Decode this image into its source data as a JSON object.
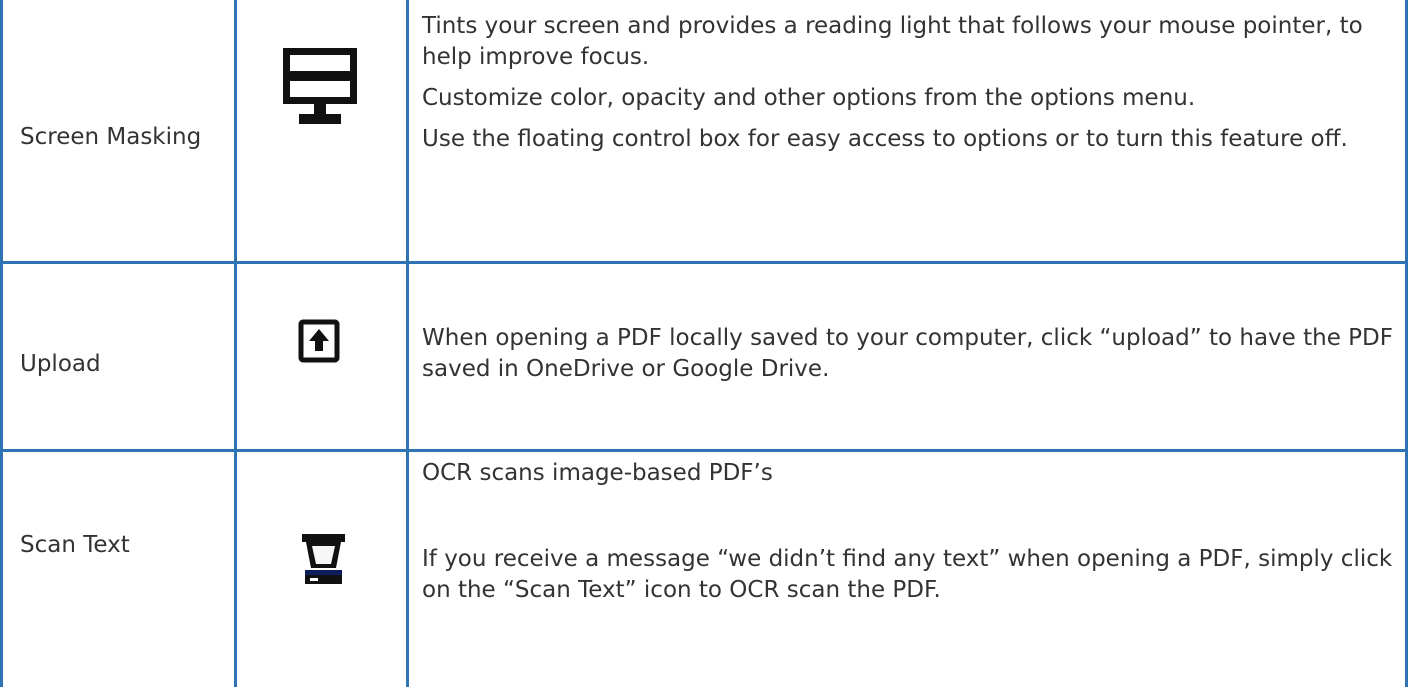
{
  "features": [
    {
      "name": "Screen Masking",
      "icon": "monitor-icon",
      "paragraphs": [
        "Tints your screen and provides a reading light that follows your mouse pointer, to help improve focus.",
        "Customize color, opacity and other options from the options menu.",
        "Use the floating control box for easy access to options or to turn this feature off."
      ]
    },
    {
      "name": "Upload",
      "icon": "upload-icon",
      "paragraphs": [
        "When opening a PDF locally saved to your computer, click “upload” to have the PDF saved in OneDrive or Google Drive."
      ]
    },
    {
      "name": "Scan Text",
      "icon": "scanner-icon",
      "paragraphs": [
        "OCR scans image-based PDF’s",
        "If you receive a message “we didn’t find any text” when opening a PDF, simply click on the “Scan Text” icon to OCR scan the PDF."
      ]
    }
  ],
  "colors": {
    "border": "#2e74b5",
    "text": "#333333",
    "icon": "#111111",
    "background": "#ffffff"
  }
}
